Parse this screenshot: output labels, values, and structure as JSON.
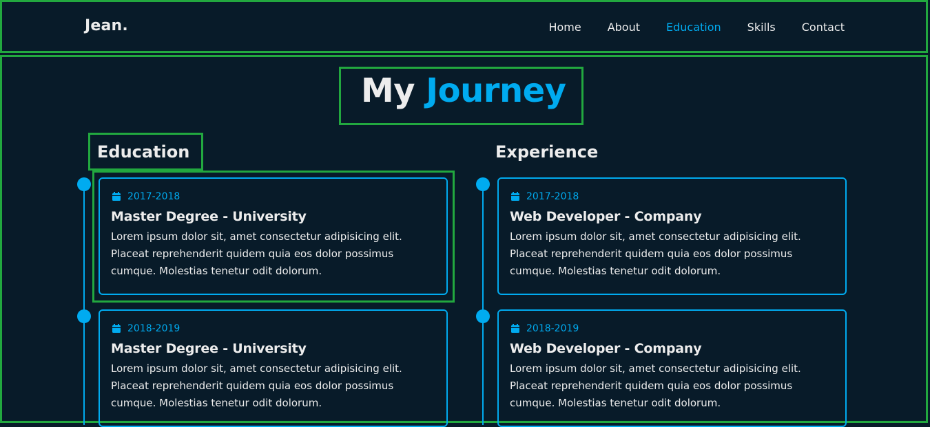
{
  "logo": "Jean.",
  "nav": {
    "items": [
      "Home",
      "About",
      "Education",
      "Skills",
      "Contact"
    ],
    "active": "Education"
  },
  "heading": {
    "prefix": "My",
    "accent": "Journey"
  },
  "education": {
    "title": "Education",
    "cards": [
      {
        "year": "2017-2018",
        "title": "Master Degree - University",
        "desc": "Lorem ipsum dolor sit, amet consectetur adipisicing elit. Placeat reprehenderit quidem quia eos dolor possimus cumque. Molestias tenetur odit dolorum."
      },
      {
        "year": "2018-2019",
        "title": "Master Degree - University",
        "desc": "Lorem ipsum dolor sit, amet consectetur adipisicing elit. Placeat reprehenderit quidem quia eos dolor possimus cumque. Molestias tenetur odit dolorum."
      }
    ]
  },
  "experience": {
    "title": "Experience",
    "cards": [
      {
        "year": "2017-2018",
        "title": "Web Developer - Company",
        "desc": "Lorem ipsum dolor sit, amet consectetur adipisicing elit. Placeat reprehenderit quidem quia eos dolor possimus cumque. Molestias tenetur odit dolorum."
      },
      {
        "year": "2018-2019",
        "title": "Web Developer - Company",
        "desc": "Lorem ipsum dolor sit, amet consectetur adipisicing elit. Placeat reprehenderit quidem quia eos dolor possimus cumque. Molestias tenetur odit dolorum."
      }
    ]
  },
  "colors": {
    "background": "#081b29",
    "accent": "#00abf0",
    "text": "#ededed",
    "annotation": "#22a83f"
  },
  "icons": {
    "year": "calendar-icon"
  }
}
